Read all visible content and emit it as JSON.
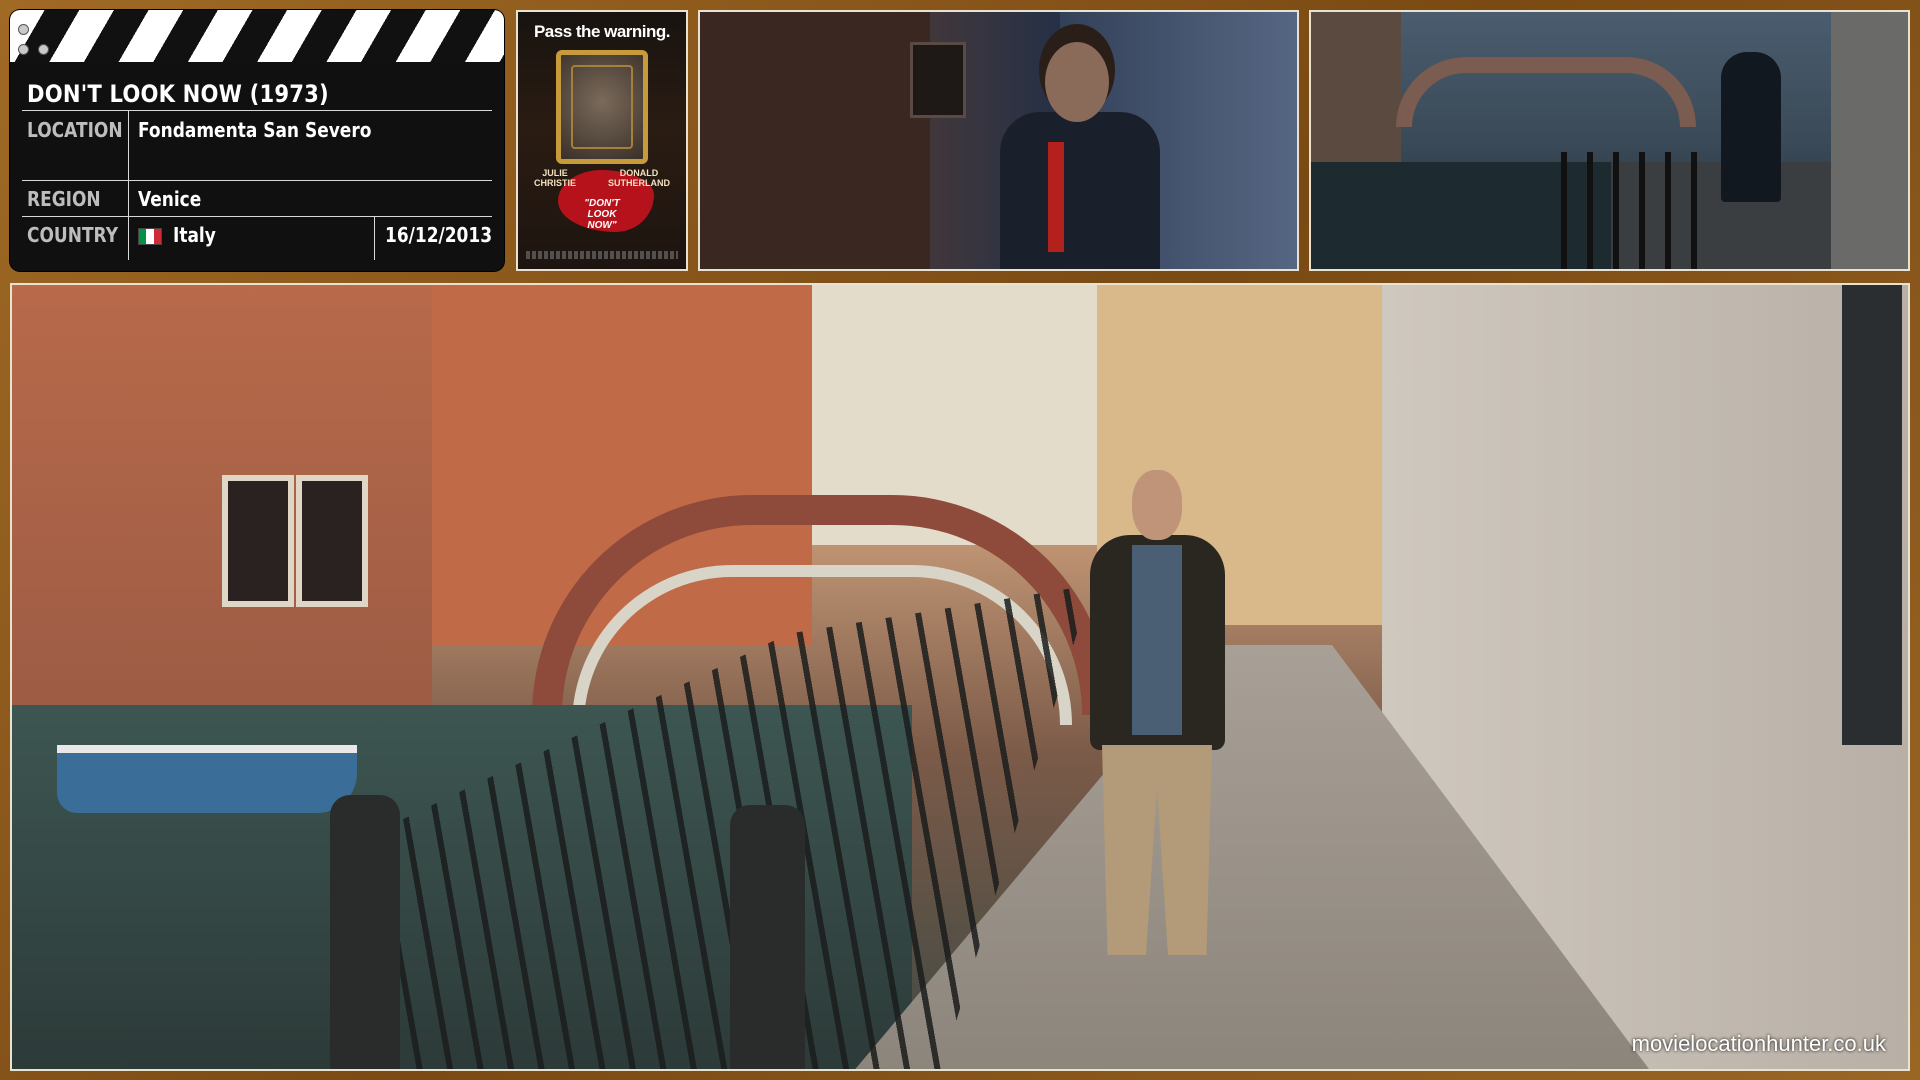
{
  "card": {
    "title": "DON'T LOOK NOW (1973)",
    "location_label": "LOCATION",
    "location_value": "Fondamenta San Severo",
    "region_label": "REGION",
    "region_value": "Venice",
    "country_label": "COUNTRY",
    "country_value": "Italy",
    "date": "16/12/2013",
    "flag_colors": [
      "#009246",
      "#ffffff",
      "#ce2b37"
    ]
  },
  "poster": {
    "tagline": "Pass the warning.",
    "star_1": "JULIE\nCHRISTIE",
    "star_2": "DONALD\nSUTHERLAND",
    "film_title": "\"DON'T\nLOOK\nNOW\""
  },
  "watermark": "movielocationhunter.co.uk",
  "colors": {
    "frame": "#8a5a1e",
    "border": "#e9e2d0"
  }
}
